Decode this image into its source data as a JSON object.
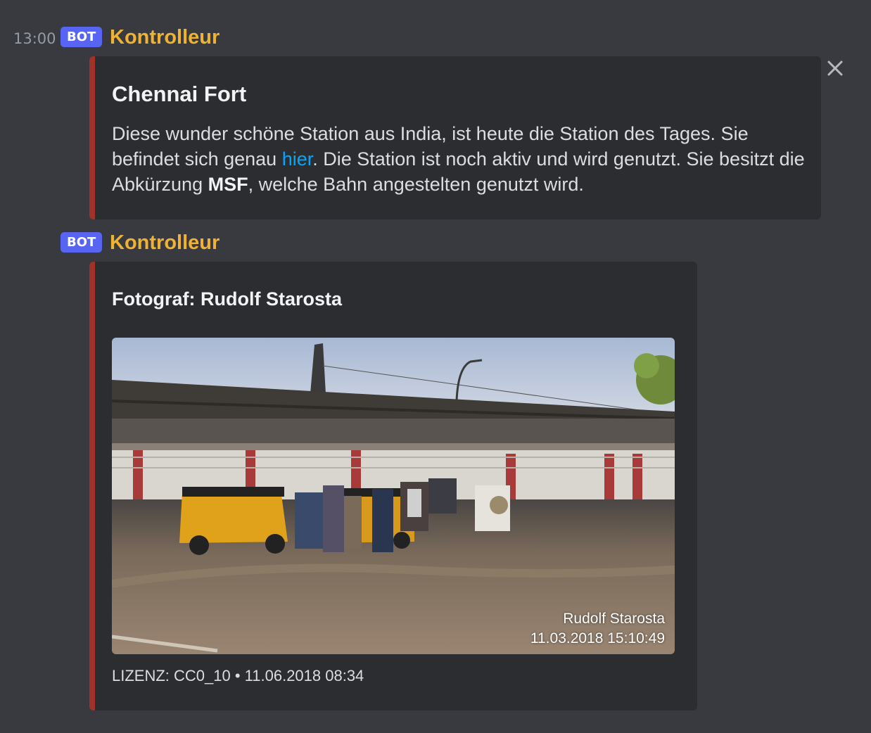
{
  "messages": [
    {
      "timestamp": "13:00",
      "bot_tag": "BOT",
      "author": "Kontrolleur",
      "embed": {
        "title": "Chennai Fort",
        "description": {
          "part1": "Diese wunder schöne Station aus India, ist heute die Station des Tages. Sie befindet sich genau ",
          "link": "hier",
          "part2": ". Die Station ist noch aktiv und wird genutzt. Sie besitzt die Abkürzung ",
          "bold": "MSF",
          "part3": ", welche Bahn angestelten genutzt wird."
        }
      }
    },
    {
      "bot_tag": "BOT",
      "author": "Kontrolleur",
      "embed": {
        "title": "Fotograf: Rudolf Starosta",
        "image_caption": {
          "name": "Rudolf Starosta",
          "datetime": "11.03.2018 15:10:49"
        },
        "footer": "LIZENZ: CC0_10 • 11.06.2018 08:34"
      }
    }
  ],
  "colors": {
    "background": "#383a40",
    "embed": "#2b2d31",
    "embed_border": "#a03228",
    "author": "#f0b232",
    "bot_tag": "#5865f2",
    "link": "#00a8fc"
  },
  "icons": {
    "close": "close-icon"
  }
}
